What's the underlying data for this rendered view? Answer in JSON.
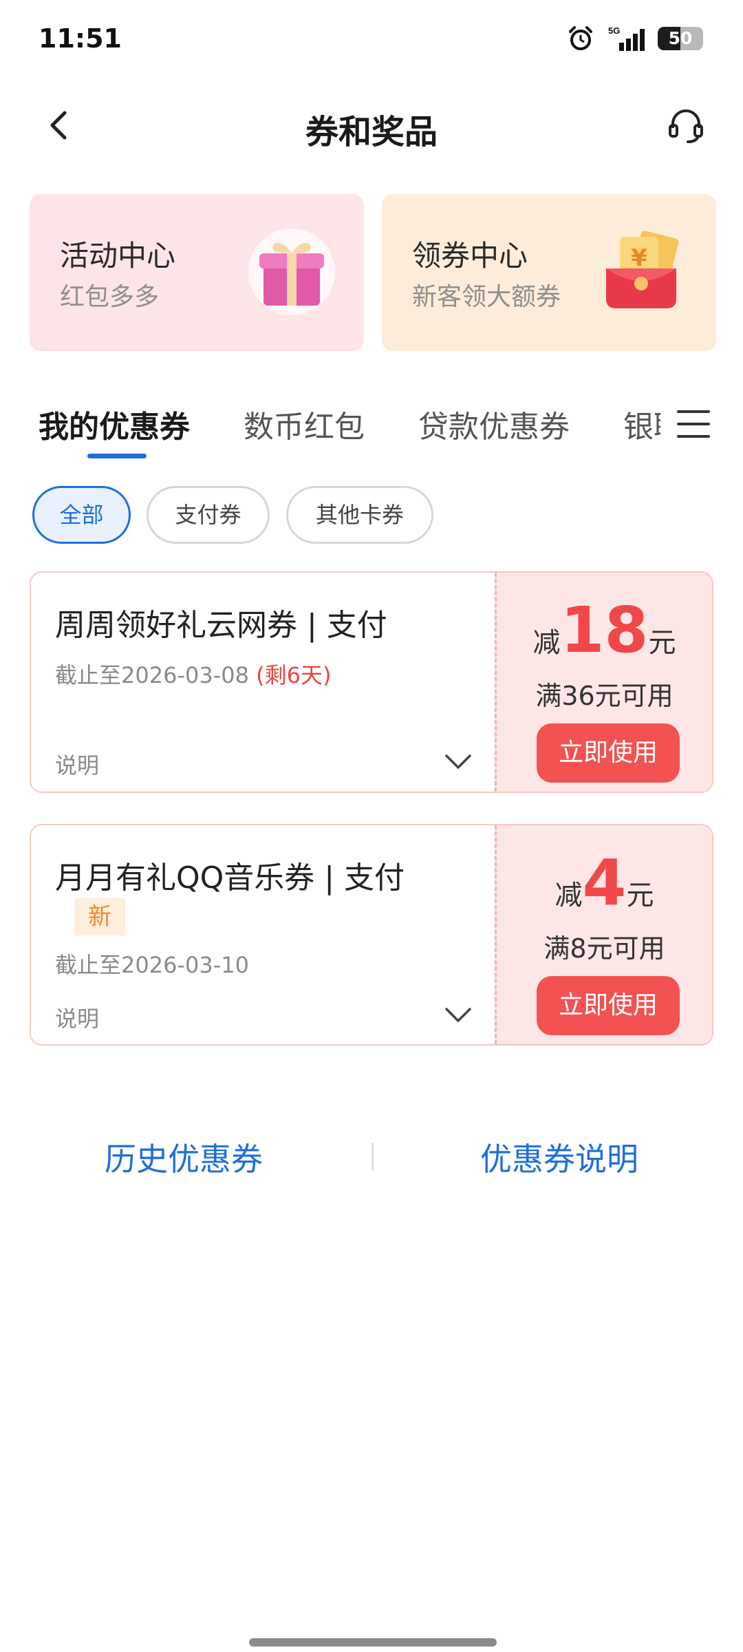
{
  "status_bar": {
    "time": "11:51",
    "network": "5G",
    "battery_level": "50",
    "battery_fraction": 0.5
  },
  "header": {
    "title": "券和奖品"
  },
  "entries": [
    {
      "title": "活动中心",
      "subtitle": "红包多多",
      "icon": "gift-box-icon",
      "background": "#fde4e6"
    },
    {
      "title": "领券中心",
      "subtitle": "新客领大额券",
      "icon": "red-envelope-coupon-icon",
      "background": "#fdecd9"
    }
  ],
  "tabs": [
    {
      "label": "我的优惠券",
      "active": true
    },
    {
      "label": "数币红包",
      "active": false
    },
    {
      "label": "贷款优惠券",
      "active": false
    },
    {
      "label": "银联",
      "active": false
    }
  ],
  "filters": [
    {
      "label": "全部",
      "active": true
    },
    {
      "label": "支付券",
      "active": false
    },
    {
      "label": "其他卡券",
      "active": false
    }
  ],
  "coupons": [
    {
      "title": "周周领好礼云网券 | 支付",
      "deadline": "截止至2026-03-08",
      "remaining": "(剩6天)",
      "explain": "说明",
      "discount_prefix": "减",
      "amount": "18",
      "unit": "元",
      "threshold": "满36元可用",
      "button": "立即使用"
    },
    {
      "title": "月月有礼QQ音乐券 | 支付",
      "tag": "新",
      "deadline": "截止至2026-03-10",
      "explain": "说明",
      "discount_prefix": "减",
      "amount": "4",
      "unit": "元",
      "threshold": "满8元可用",
      "button": "立即使用"
    }
  ],
  "footer": {
    "history": "历史优惠券",
    "instructions": "优惠券说明"
  },
  "colors": {
    "accent": "#1e6fd9",
    "discount": "#f04848",
    "button": "#f25252",
    "coupon_right_bg": "#fde6e6"
  }
}
